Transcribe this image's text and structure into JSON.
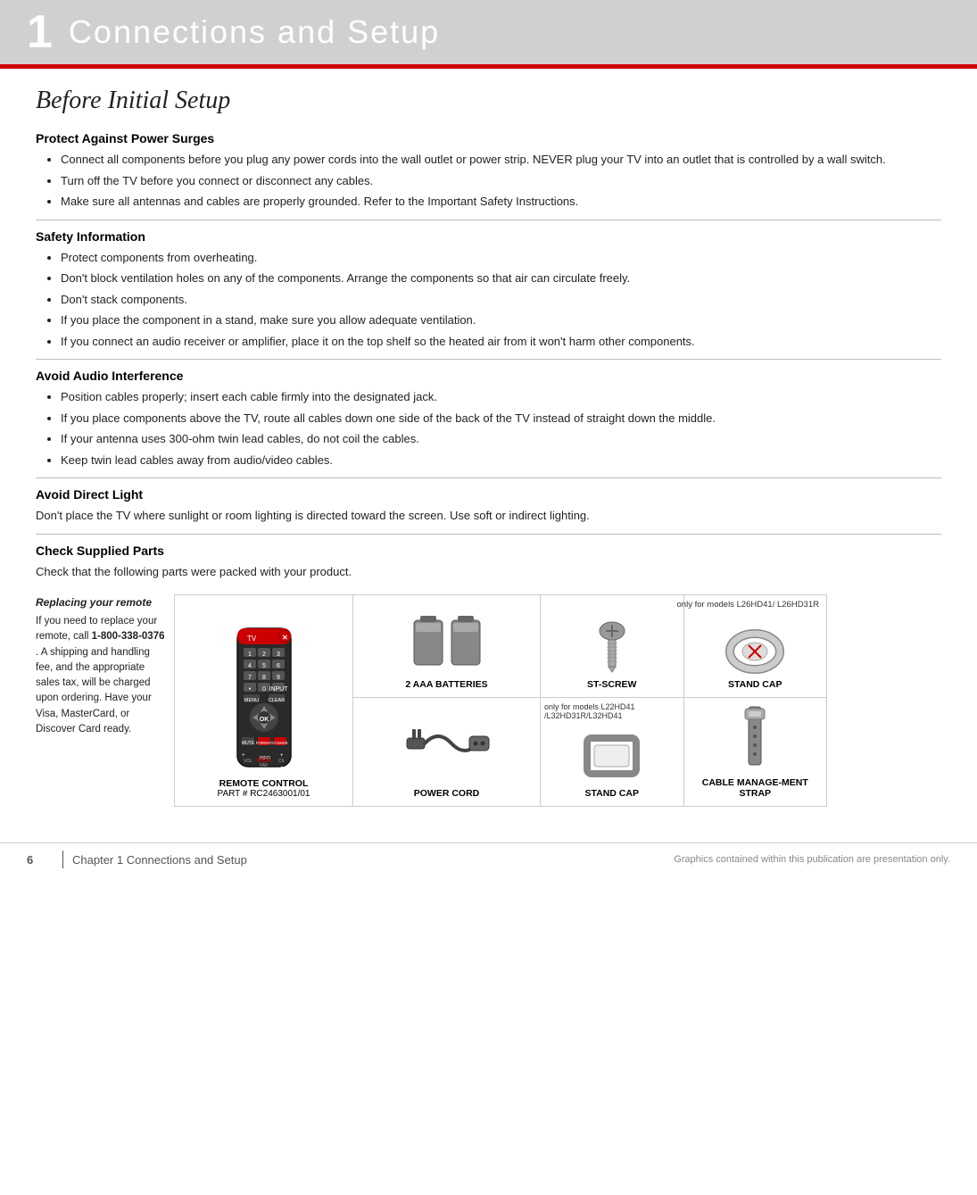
{
  "header": {
    "chapter_number": "1",
    "chapter_title": "Connections and Setup"
  },
  "page": {
    "section_italic_title": "Before Initial Setup",
    "sections": [
      {
        "id": "protect",
        "heading": "Protect Against Power Surges",
        "bullets": [
          "Connect all components before you plug any power cords into the wall outlet or power strip. NEVER plug your TV into an outlet that is controlled by a wall switch.",
          "Turn off the TV before you connect or disconnect any cables.",
          "Make sure all antennas and cables are properly grounded. Refer to the Important Safety Instructions."
        ]
      },
      {
        "id": "safety",
        "heading": "Safety Information",
        "bullets": [
          "Protect components from overheating.",
          "Don't block ventilation holes on any of the components. Arrange the components so that air can circulate freely.",
          "Don't stack components.",
          "If you place the component in a stand, make sure you allow adequate ventilation.",
          "If you connect an audio receiver or amplifier, place it on the top shelf so the heated air from it won't harm other components."
        ]
      },
      {
        "id": "audio",
        "heading": "Avoid Audio Interference",
        "bullets": [
          "Position cables properly; insert each cable firmly into the designated jack.",
          "If you place components above the TV, route all cables down one side of the back of the TV instead of straight down the middle.",
          "If your antenna uses 300-ohm twin lead cables, do not coil the cables.",
          "Keep twin lead cables away from audio/video cables."
        ]
      },
      {
        "id": "light",
        "heading": "Avoid Direct Light",
        "plain": "Don't place the TV where sunlight or room lighting is directed toward the screen. Use soft or indirect lighting."
      },
      {
        "id": "parts",
        "heading": "Check Supplied Parts",
        "plain": "Check that the following parts were packed with your product."
      }
    ],
    "sidebar": {
      "title": "Replacing your remote",
      "body": "If you need to replace your remote, call",
      "phone": "1-800-338-0376",
      "suffix": ".  A shipping and handling fee, and the appropriate sales tax, will be charged upon ordering.  Have your Visa, MasterCard, or Discover Card ready."
    },
    "parts": [
      {
        "id": "remote",
        "label": "REMOTE CONTROL",
        "sublabel": "PART # RC2463001/01",
        "note": ""
      },
      {
        "id": "batteries",
        "label": "2 AAA BATTERIES",
        "sublabel": "",
        "note": ""
      },
      {
        "id": "screw",
        "label": "ST-SCREW",
        "sublabel": "",
        "note": "only for models L26HD41/ L26HD31R"
      },
      {
        "id": "standcap_top",
        "label": "STAND CAP",
        "sublabel": "",
        "note": ""
      },
      {
        "id": "powercord",
        "label": "POWER CORD",
        "sublabel": "",
        "note": ""
      },
      {
        "id": "standcap_bottom",
        "label": "STAND CAP",
        "sublabel": "",
        "note": "only for models L22HD41 /L32HD31R/L32HD41"
      },
      {
        "id": "cablestrap",
        "label": "CABLE MANAGE-MENT STRAP",
        "sublabel": "",
        "note": ""
      }
    ],
    "footer": {
      "page_number": "6",
      "chapter_label": "Chapter 1    Connections and Setup",
      "note": "Graphics contained within this publication are presentation only."
    }
  }
}
